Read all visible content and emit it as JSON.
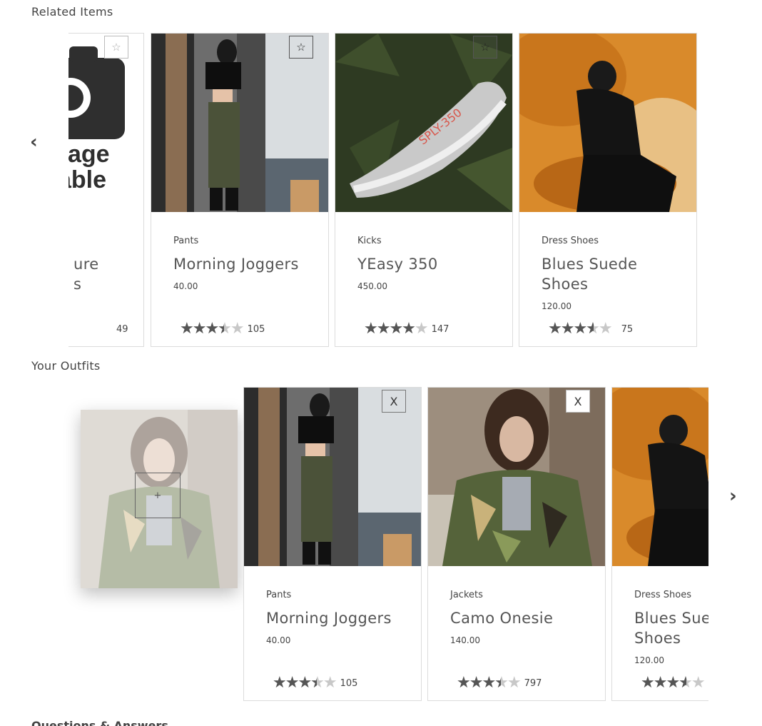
{
  "related": {
    "title": "Related Items",
    "prev_arrow": "‹",
    "cards": [
      {
        "category": "",
        "name": "ure\ns",
        "price": "",
        "rating": 3.5,
        "count": "49",
        "button": "☆",
        "button_style": "light",
        "image": "placeholder-camera"
      },
      {
        "category": "Pants",
        "name": "Morning Joggers",
        "price": "40.00",
        "rating": 3.5,
        "count": "105",
        "button": "☆",
        "button_style": "dark",
        "image": "joggers"
      },
      {
        "category": "Kicks",
        "name": "YEasy 350",
        "price": "450.00",
        "rating": 4,
        "count": "147",
        "button": "☆",
        "button_style": "dark",
        "image": "sneaker"
      },
      {
        "category": "Dress Shoes",
        "name": "Blues Suede Shoes",
        "price": "120.00",
        "rating": 3.6,
        "count": "75",
        "button": "",
        "button_style": "none",
        "image": "suede"
      }
    ],
    "placeholder_text": [
      "age",
      "able"
    ]
  },
  "outfits": {
    "title": "Your Outfits",
    "add_symbol": "+",
    "next_arrow": "›",
    "cards": [
      {
        "category": "Pants",
        "name": "Morning Joggers",
        "price": "40.00",
        "rating": 3.5,
        "count": "105",
        "button": "X",
        "image": "joggers"
      },
      {
        "category": "Jackets",
        "name": "Camo Onesie",
        "price": "140.00",
        "rating": 3.5,
        "count": "797",
        "button": "X",
        "image": "camo"
      },
      {
        "category": "Dress Shoes",
        "name": "Blues Suede Shoes",
        "price": "120.00",
        "rating": 3.6,
        "count": "",
        "button": "",
        "image": "suede"
      }
    ]
  },
  "qa": {
    "title": "Questions & Answers"
  }
}
